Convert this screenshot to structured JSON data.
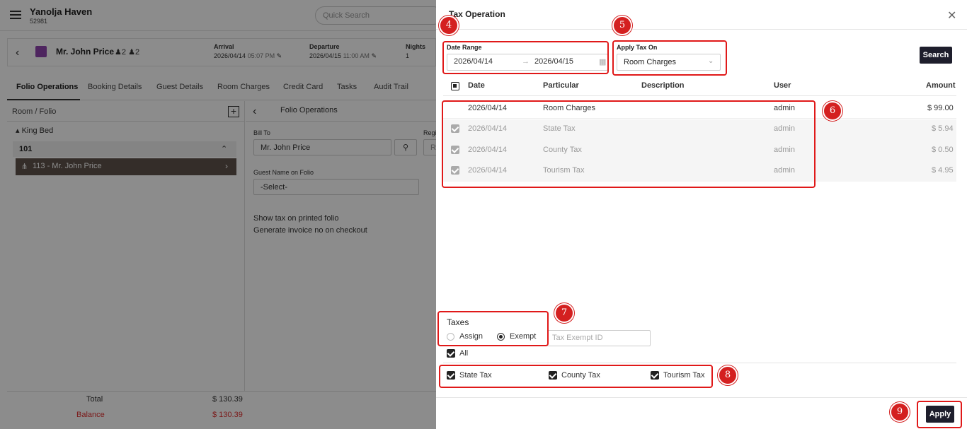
{
  "app": {
    "hotel_name": "Yanolja Haven",
    "hotel_id": "52981",
    "search_placeholder": "Quick Search"
  },
  "guest": {
    "name": "Mr. John Price",
    "adults": "2",
    "children": "2",
    "arrival_label": "Arrival",
    "arrival_date": "2026/04/14",
    "arrival_time": "05:07 PM",
    "departure_label": "Departure",
    "departure_date": "2026/04/15",
    "departure_time": "11:00 AM",
    "nights_label": "Nights",
    "nights": "1"
  },
  "tabs": [
    "Folio Operations",
    "Booking Details",
    "Guest Details",
    "Room Charges",
    "Credit Card",
    "Tasks",
    "Audit Trail"
  ],
  "left_pane": {
    "header": "Room / Folio",
    "room_type": "King Bed",
    "room_no": "101",
    "folio": "113 - Mr. John Price",
    "total_label": "Total",
    "total_value": "$ 130.39",
    "balance_label": "Balance",
    "balance_value": "$ 130.39"
  },
  "mid_pane": {
    "title": "Folio Operations",
    "bill_to_label": "Bill To",
    "bill_to_value": "Mr. John Price",
    "reg_label": "Regi",
    "reg_value": "R",
    "guest_name_label": "Guest Name on Folio",
    "guest_name_value": "-Select-",
    "opt1": "Show tax on printed folio",
    "opt2": "Generate invoice no on checkout"
  },
  "modal": {
    "title": "Tax Operation",
    "date_range_label": "Date Range",
    "date_from": "2026/04/14",
    "date_to": "2026/04/15",
    "apply_tax_on_label": "Apply Tax On",
    "apply_tax_on_value": "Room Charges",
    "search_label": "Search",
    "columns": {
      "date": "Date",
      "particular": "Particular",
      "description": "Description",
      "user": "User",
      "amount": "Amount"
    },
    "rows": [
      {
        "date": "2026/04/14",
        "particular": "Room Charges",
        "description": "",
        "user": "admin",
        "amount": "$ 99.00"
      },
      {
        "date": "2026/04/14",
        "particular": "State Tax",
        "description": "",
        "user": "admin",
        "amount": "$ 5.94"
      },
      {
        "date": "2026/04/14",
        "particular": "County Tax",
        "description": "",
        "user": "admin",
        "amount": "$ 0.50"
      },
      {
        "date": "2026/04/14",
        "particular": "Tourism Tax",
        "description": "",
        "user": "admin",
        "amount": "$ 4.95"
      }
    ],
    "taxes_label": "Taxes",
    "assign_label": "Assign",
    "exempt_label": "Exempt",
    "tax_exempt_placeholder": "Tax Exempt ID",
    "all_label": "All",
    "tax_options": [
      "State Tax",
      "County Tax",
      "Tourism Tax"
    ],
    "apply_label": "Apply"
  },
  "callouts": [
    "4",
    "5",
    "6",
    "7",
    "8",
    "9"
  ],
  "colors": {
    "callout_red": "#d42020",
    "dark_button": "#1e1e2c",
    "folio_selected": "#5f534b",
    "balance_red": "#e03030"
  }
}
